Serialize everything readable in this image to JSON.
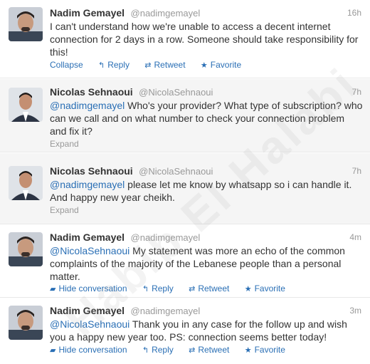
{
  "colors": {
    "link": "#2a6fb5",
    "muted": "#999999",
    "text": "#333333",
    "shaded_bg": "#f5f5f5"
  },
  "watermark": "Habib El Halabi",
  "tweets": [
    {
      "name": "Nadim Gemayel",
      "handle": "@nadimgemayel",
      "time": "16h",
      "mention": "",
      "text": "I can't understand how we're unable to access a decent internet connection for 2 days in a row. Someone should take responsibility for this!",
      "actions": {
        "toggle": "Collapse",
        "reply": "Reply",
        "retweet": "Retweet",
        "favorite": "Favorite"
      }
    },
    {
      "name": "Nicolas Sehnaoui",
      "handle": "@NicolaSehnaoui",
      "time": "7h",
      "mention": "@nadimgemayel",
      "text": " Who's your provider? What type of subscription? who can we call and on what number to check your connection problem and fix it?",
      "expand": "Expand"
    },
    {
      "name": "Nicolas Sehnaoui",
      "handle": "@NicolaSehnaoui",
      "time": "7h",
      "mention": "@nadimgemayel",
      "text": " please let me know by whatsapp so i can handle it. And happy new year cheikh.",
      "expand": "Expand"
    },
    {
      "name": "Nadim Gemayel",
      "handle": "@nadimgemayel",
      "time": "4m",
      "mention": "@NicolaSehnaoui",
      "text": " My statement was more an echo of the common complaints of the majority of the Lebanese people than a personal matter.",
      "actions": {
        "toggle": "Hide conversation",
        "reply": "Reply",
        "retweet": "Retweet",
        "favorite": "Favorite"
      }
    },
    {
      "name": "Nadim Gemayel",
      "handle": "@nadimgemayel",
      "time": "3m",
      "mention": "@NicolaSehnaoui",
      "text": " Thank you in any case for the follow up and wish you a happy new year too. PS: connection seems better today!",
      "actions": {
        "toggle": "Hide conversation",
        "reply": "Reply",
        "retweet": "Retweet",
        "favorite": "Favorite"
      }
    }
  ]
}
